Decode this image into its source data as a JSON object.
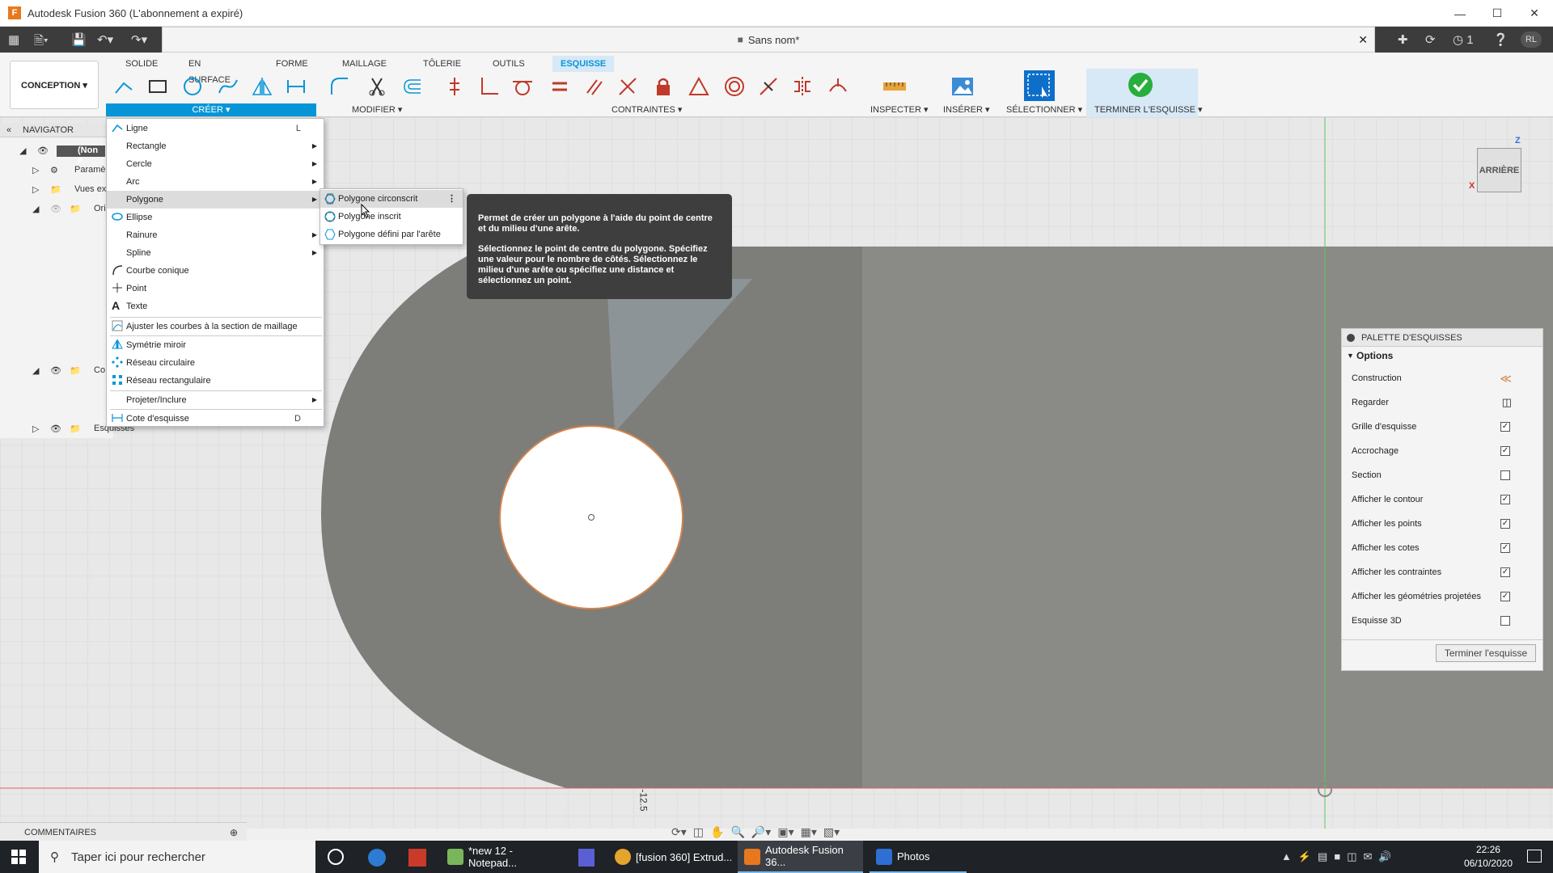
{
  "window": {
    "title": "Autodesk Fusion 360 (L'abonnement a expiré)",
    "doc_title": "Sans nom*",
    "job_count": "1",
    "user_initials": "RL"
  },
  "ribbon": {
    "workspace": "CONCEPTION ▾",
    "tabs": [
      "SOLIDE",
      "EN SURFACE",
      "FORME",
      "MAILLAGE",
      "TÔLERIE",
      "OUTILS",
      "ESQUISSE"
    ],
    "groups": {
      "creer": "CRÉER ▾",
      "modifier": "MODIFIER ▾",
      "contraintes": "CONTRAINTES ▾",
      "inspecter": "INSPECTER ▾",
      "inserer": "INSÉRER ▾",
      "selectionner": "SÉLECTIONNER ▾",
      "terminer": "TERMINER L'ESQUISSE ▾"
    }
  },
  "navigator": {
    "title": "NAVIGATOR",
    "rows": [
      "(Non e",
      "Paramè",
      "Vues ex",
      "Ori",
      "Co",
      "Esquisses"
    ]
  },
  "creer_menu": {
    "items": [
      {
        "label": "Ligne",
        "shortcut": "L"
      },
      {
        "label": "Rectangle"
      },
      {
        "label": "Cercle"
      },
      {
        "label": "Arc"
      },
      {
        "label": "Polygone"
      },
      {
        "label": "Ellipse"
      },
      {
        "label": "Rainure"
      },
      {
        "label": "Spline"
      },
      {
        "label": "Courbe conique"
      },
      {
        "label": "Point"
      },
      {
        "label": "Texte"
      },
      {
        "label": "Ajuster les courbes à la section de maillage"
      },
      {
        "label": "Symétrie miroir"
      },
      {
        "label": "Réseau circulaire"
      },
      {
        "label": "Réseau rectangulaire"
      },
      {
        "label": "Projeter/Inclure"
      },
      {
        "label": "Cote d'esquisse",
        "shortcut": "D"
      }
    ]
  },
  "polygon_submenu": {
    "items": [
      "Polygone circonscrit",
      "Polygone inscrit",
      "Polygone défini par l'arête"
    ]
  },
  "tooltip": {
    "line1": "Permet de créer un polygone à l'aide du point de centre et du milieu d'une arête.",
    "line2": "Sélectionnez le point de centre du polygone. Spécifiez une valeur pour le nombre de côtés. Sélectionnez le milieu d'une arête ou spécifiez une distance et sélectionnez un point."
  },
  "palette": {
    "title": "PALETTE D'ESQUISSES",
    "options_label": "Options",
    "rows": [
      {
        "label": "Construction",
        "checked": null
      },
      {
        "label": "Regarder",
        "checked": null
      },
      {
        "label": "Grille d'esquisse",
        "checked": true
      },
      {
        "label": "Accrochage",
        "checked": true
      },
      {
        "label": "Section",
        "checked": false
      },
      {
        "label": "Afficher le contour",
        "checked": true
      },
      {
        "label": "Afficher les points",
        "checked": true
      },
      {
        "label": "Afficher les cotes",
        "checked": true
      },
      {
        "label": "Afficher les contraintes",
        "checked": true
      },
      {
        "label": "Afficher les géométries projetées",
        "checked": true
      },
      {
        "label": "Esquisse 3D",
        "checked": false
      }
    ],
    "finish_button": "Terminer l'esquisse"
  },
  "viewcube": {
    "face": "ARRIÈRE",
    "axis_z": "Z",
    "axis_x": "X"
  },
  "canvas": {
    "dimension_label": "-12.5"
  },
  "comments": {
    "label": "COMMENTAIRES"
  },
  "taskbar": {
    "search_placeholder": "Taper ici pour rechercher",
    "apps": [
      "*new 12 - Notepad...",
      "[fusion 360] Extrud...",
      "Autodesk Fusion 36...",
      "Photos"
    ],
    "time": "22:26",
    "date": "06/10/2020"
  }
}
